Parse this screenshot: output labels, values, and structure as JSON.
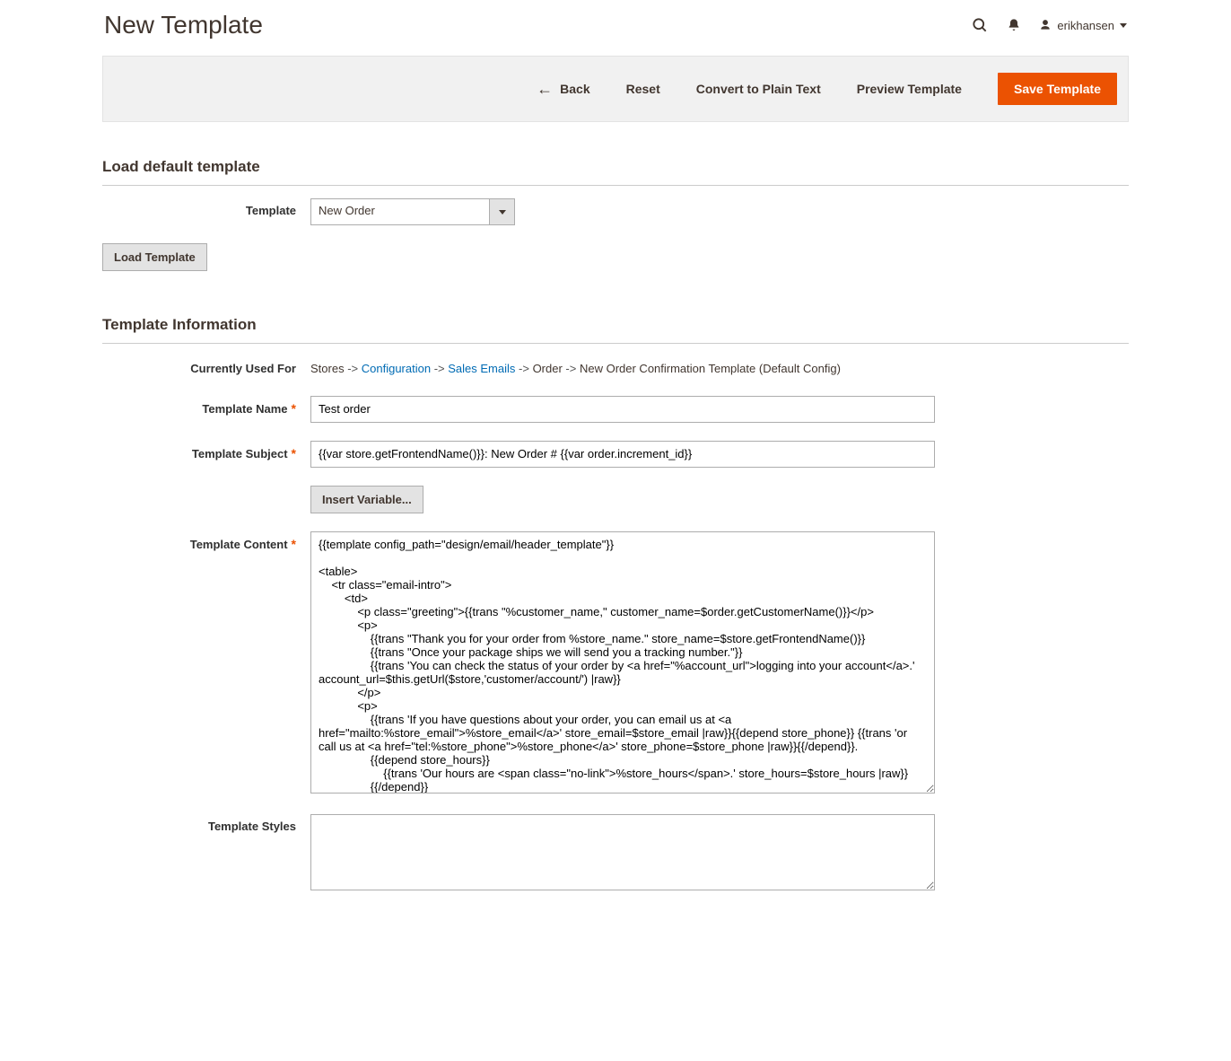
{
  "header": {
    "title": "New Template",
    "username": "erikhansen"
  },
  "actions": {
    "back": "Back",
    "reset": "Reset",
    "convert": "Convert to Plain Text",
    "preview": "Preview Template",
    "save": "Save Template"
  },
  "load_section": {
    "title": "Load default template",
    "template_label": "Template",
    "template_value": "New Order",
    "load_button": "Load Template"
  },
  "info_section": {
    "title": "Template Information",
    "used_for_label": "Currently Used For",
    "breadcrumb": {
      "p1": "Stores",
      "p2": "Configuration",
      "p3": "Sales Emails",
      "p4": "Order",
      "p5": "New Order Confirmation Template  (Default Config)"
    },
    "name_label": "Template Name",
    "name_value": "Test order",
    "subject_label": "Template Subject",
    "subject_value": "{{var store.getFrontendName()}}: New Order # {{var order.increment_id}}",
    "insert_variable": "Insert Variable...",
    "content_label": "Template Content",
    "content_value": "{{template config_path=\"design/email/header_template\"}}\n\n<table>\n    <tr class=\"email-intro\">\n        <td>\n            <p class=\"greeting\">{{trans \"%customer_name,\" customer_name=$order.getCustomerName()}}</p>\n            <p>\n                {{trans \"Thank you for your order from %store_name.\" store_name=$store.getFrontendName()}}\n                {{trans \"Once your package ships we will send you a tracking number.\"}}\n                {{trans 'You can check the status of your order by <a href=\"%account_url\">logging into your account</a>.' account_url=$this.getUrl($store,'customer/account/') |raw}}\n            </p>\n            <p>\n                {{trans 'If you have questions about your order, you can email us at <a href=\"mailto:%store_email\">%store_email</a>' store_email=$store_email |raw}}{{depend store_phone}} {{trans 'or call us at <a href=\"tel:%store_phone\">%store_phone</a>' store_phone=$store_phone |raw}}{{/depend}}.\n                {{depend store_hours}}\n                    {{trans 'Our hours are <span class=\"no-link\">%store_hours</span>.' store_hours=$store_hours |raw}}\n                {{/depend}}\n            </p>\n        </td>",
    "styles_label": "Template Styles",
    "styles_value": ""
  }
}
